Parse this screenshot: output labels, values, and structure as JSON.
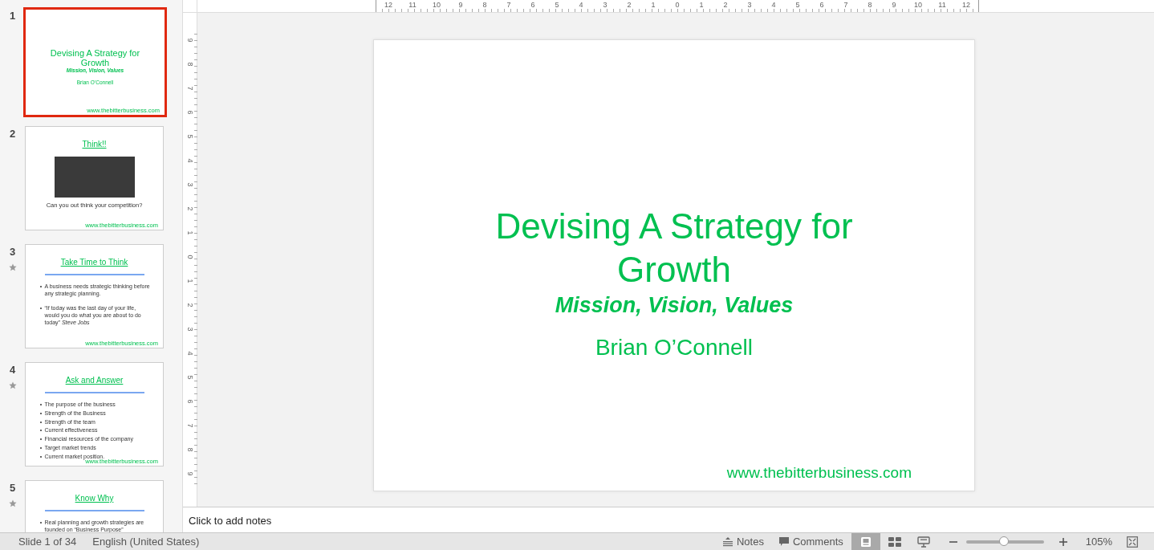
{
  "slides": [
    {
      "number": "1",
      "selected": true,
      "animated": false,
      "kind": "title",
      "title": "Devising A Strategy for Growth",
      "subtitle": "Mission, Vision, Values",
      "author": "Brian O’Connell",
      "footer": "www.thebitterbusiness.com"
    },
    {
      "number": "2",
      "selected": false,
      "animated": false,
      "kind": "image",
      "title": "Think!!",
      "caption": "Can you out think your competition?",
      "footer": "www.thebitterbusiness.com"
    },
    {
      "number": "3",
      "selected": false,
      "animated": true,
      "kind": "bullets",
      "title": "Take Time to Think",
      "bullets": [
        "A business needs strategic thinking before any strategic planning.",
        "“If today was the last day of your life, would you do what you are about to do today” *Steve Jobs*"
      ],
      "footer": "www.thebitterbusiness.com"
    },
    {
      "number": "4",
      "selected": false,
      "animated": true,
      "kind": "bullets",
      "title": "Ask and Answer",
      "bullets": [
        "The purpose of the business",
        "Strength of the Business",
        "Strength of the team",
        "Current effectiveness",
        "Financial resources of the company",
        "Target market trends",
        "Current market position."
      ],
      "footer": "www.thebitterbusiness.com"
    },
    {
      "number": "5",
      "selected": false,
      "animated": true,
      "kind": "bullets",
      "title": "Know Why",
      "bullets": [
        "Real planning and growth strategies are founded on “Business Purpose”"
      ]
    }
  ],
  "ruler": {
    "horizontal": [
      "12",
      "11",
      "10",
      "9",
      "8",
      "7",
      "6",
      "5",
      "4",
      "3",
      "2",
      "1",
      "0",
      "1",
      "2",
      "3",
      "4",
      "5",
      "6",
      "7",
      "8",
      "9",
      "10",
      "11",
      "12"
    ],
    "vertical": [
      "9",
      "8",
      "7",
      "6",
      "5",
      "4",
      "3",
      "2",
      "1",
      "0",
      "1",
      "2",
      "3",
      "4",
      "5",
      "6",
      "7",
      "8",
      "9"
    ]
  },
  "slide": {
    "title": "Devising A Strategy for Growth",
    "subtitle": "Mission, Vision, Values",
    "author": "Brian O’Connell",
    "footer": "www.thebitterbusiness.com"
  },
  "notes": {
    "placeholder": "Click to add notes"
  },
  "status_bar": {
    "slide_info": "Slide 1 of 34",
    "language": "English (United States)",
    "notes_button": "Notes",
    "comments_button": "Comments",
    "views": [
      {
        "kind": "normal",
        "selected": true
      },
      {
        "kind": "sorter",
        "selected": false
      },
      {
        "kind": "presenter",
        "selected": false
      }
    ],
    "zoom": {
      "level": 0.49,
      "label": "105%"
    }
  }
}
